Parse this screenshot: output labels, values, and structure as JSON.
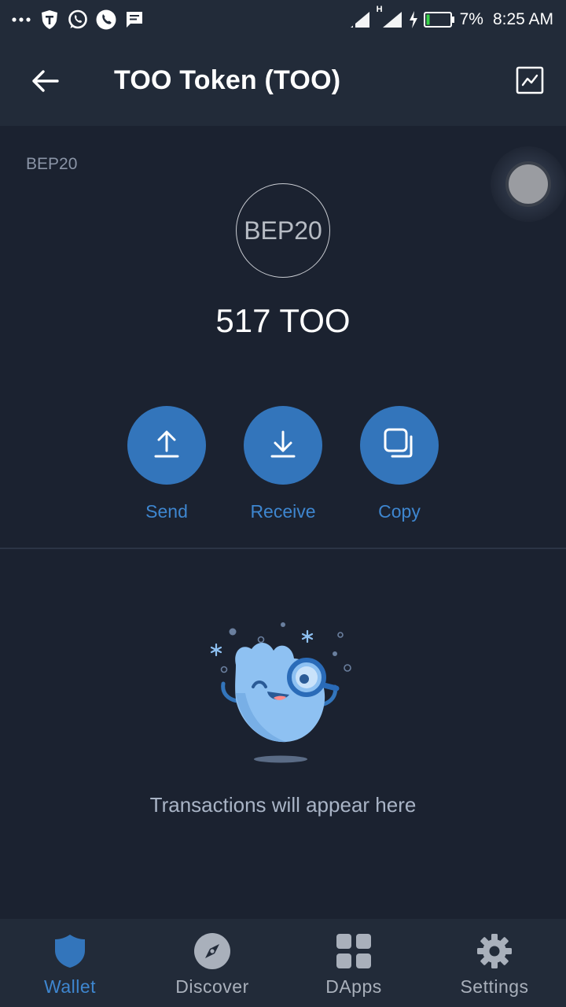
{
  "status_bar": {
    "left_icons": [
      "more-dots-icon",
      "shield-app-icon",
      "whatsapp-icon",
      "phone-icon",
      "message-icon"
    ],
    "network_type": "H",
    "battery_percent": "7%",
    "time": "8:25 AM"
  },
  "header": {
    "title": "TOO Token (TOO)",
    "back_icon": "arrow-left-icon",
    "chart_icon": "line-chart-icon"
  },
  "token": {
    "network": "BEP20",
    "logo_text": "BEP20",
    "balance": "517 TOO"
  },
  "actions": [
    {
      "label": "Send",
      "icon": "upload-arrow-icon"
    },
    {
      "label": "Receive",
      "icon": "download-arrow-icon"
    },
    {
      "label": "Copy",
      "icon": "copy-icon"
    }
  ],
  "empty_state": {
    "text": "Transactions will appear here"
  },
  "bottom_nav": {
    "items": [
      {
        "label": "Wallet",
        "icon": "shield-icon",
        "active": true
      },
      {
        "label": "Discover",
        "icon": "compass-icon",
        "active": false
      },
      {
        "label": "DApps",
        "icon": "grid-icon",
        "active": false
      },
      {
        "label": "Settings",
        "icon": "gear-icon",
        "active": false
      }
    ]
  },
  "colors": {
    "background": "#1b2230",
    "header": "#222b39",
    "accent": "#3375bb",
    "accent_text": "#3e86cf"
  }
}
